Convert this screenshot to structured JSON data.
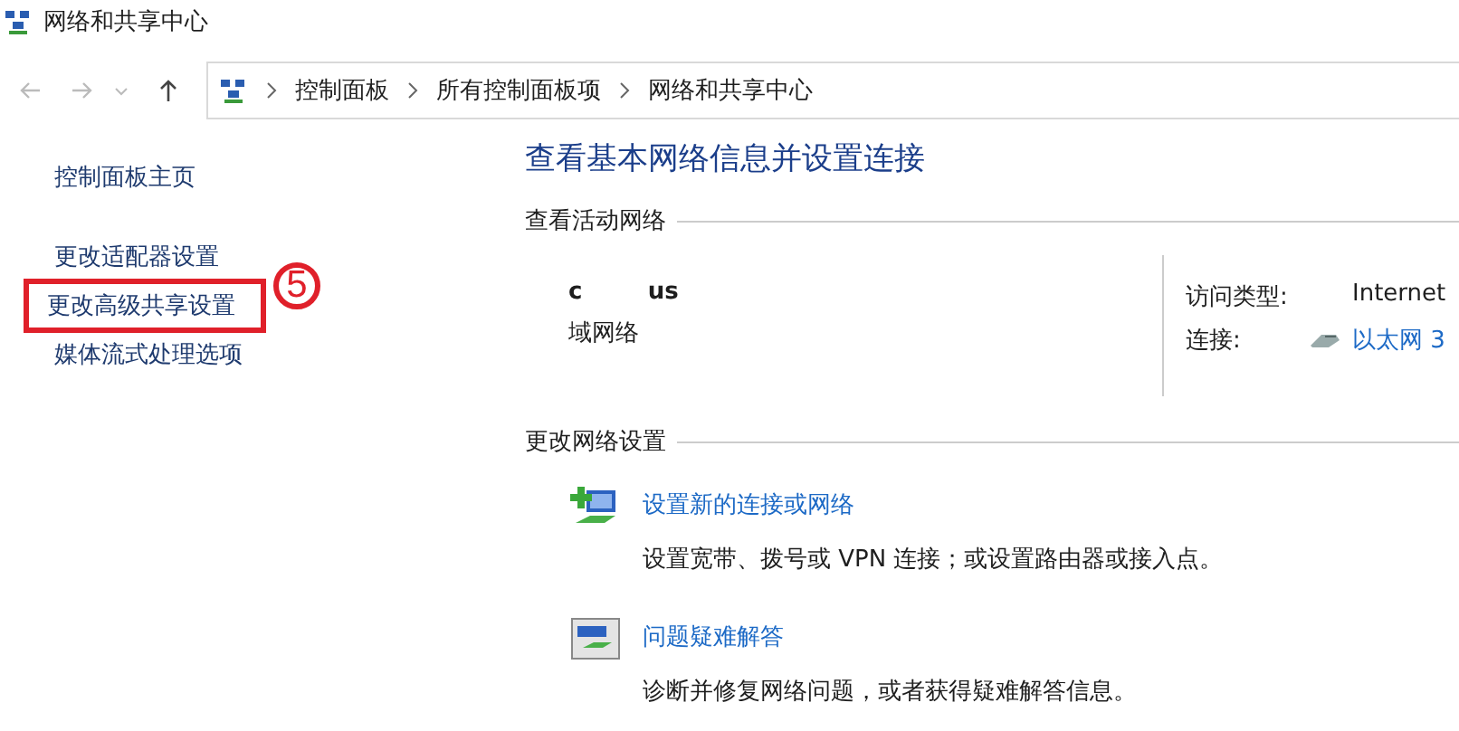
{
  "window": {
    "title": "网络和共享中心"
  },
  "breadcrumb": [
    "控制面板",
    "所有控制面板项",
    "网络和共享中心"
  ],
  "sidebar": {
    "home": "控制面板主页",
    "items": [
      {
        "label": "更改适配器设置",
        "highlighted": false
      },
      {
        "label": "更改高级共享设置",
        "highlighted": true
      },
      {
        "label": "媒体流式处理选项",
        "highlighted": false
      }
    ],
    "annotation": "5"
  },
  "heading": "查看基本网络信息并设置连接",
  "active_networks": {
    "title": "查看活动网络",
    "name": "c        us",
    "type": "域网络",
    "details": [
      {
        "label": "访问类型:",
        "value": "Internet",
        "kind": "text"
      },
      {
        "label": "连接:",
        "value": "以太网 3",
        "kind": "link"
      }
    ]
  },
  "change_settings": {
    "title": "更改网络设置",
    "items": [
      {
        "kind": "new",
        "link": "设置新的连接或网络",
        "description": "设置宽带、拨号或 VPN 连接；或设置路由器或接入点。"
      },
      {
        "kind": "troubleshoot",
        "link": "问题疑难解答",
        "description": "诊断并修复网络问题，或者获得疑难解答信息。"
      }
    ]
  }
}
